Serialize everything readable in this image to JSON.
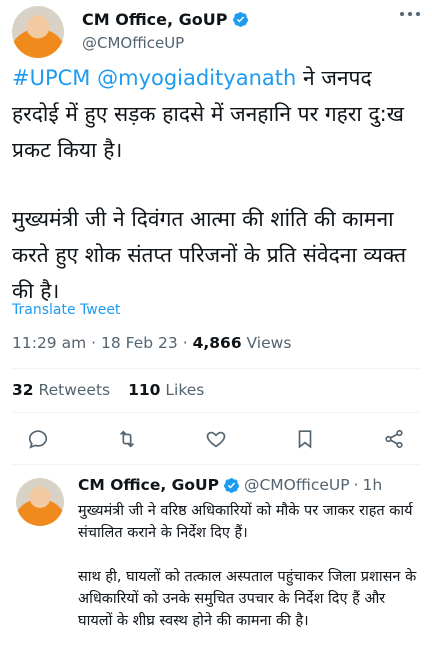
{
  "main_tweet": {
    "display_name": "CM Office, GoUP",
    "handle": "@CMOfficeUP",
    "text_hashtag": "#UPCM",
    "text_mention": "@myogiadityanath",
    "text_rest": "ने जनपद हरदोई में हुए सड़क हादसे में जनहानि पर गहरा दु:ख प्रकट किया है।",
    "text_paragraph_2": "मुख्यमंत्री जी ने दिवंगत आत्मा की शांति की कामना करते हुए शोक संतप्त परिजनों के प्रति संवेदना व्यक्त की है।",
    "translate_label": "Translate Tweet",
    "time": "11:29 am",
    "date": "18 Feb 23",
    "separator": "·",
    "views_count": "4,866",
    "views_label": "Views",
    "retweets_count": "32",
    "retweets_label": "Retweets",
    "likes_count": "110",
    "likes_label": "Likes"
  },
  "reply_tweet": {
    "display_name": "CM Office, GoUP",
    "handle": "@CMOfficeUP",
    "separator": "·",
    "time": "1h",
    "paragraph_1": "मुख्यमंत्री जी ने वरिष्ठ अधिकारियों को मौके पर जाकर राहत कार्य संचालित कराने के निर्देश दिए हैं।",
    "paragraph_2": "साथ ही, घायलों को तत्काल अस्पताल पहुंचाकर जिला प्रशासन के अधिकारियों को उनके समुचित उपचार के निर्देश दिए हैं और घायलों के शीघ्र स्वस्थ होने की कामना की है।"
  },
  "colors": {
    "accent": "#1d9bf0",
    "text": "#0f1419",
    "muted": "#536471",
    "divider": "#eff3f4"
  },
  "icons": [
    "verified-badge-icon",
    "more-icon",
    "reply-icon",
    "retweet-icon",
    "like-icon",
    "bookmark-icon",
    "share-icon"
  ]
}
